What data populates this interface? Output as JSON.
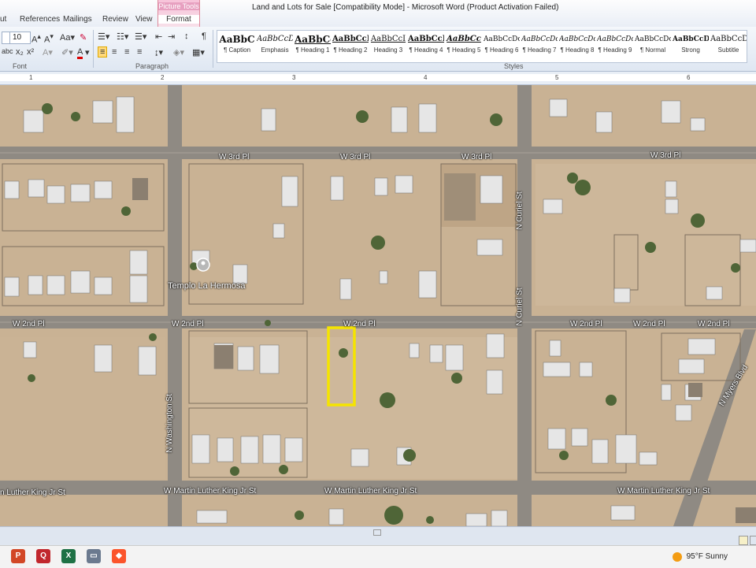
{
  "window": {
    "doc_title": "Land and Lots for Sale [Compatibility Mode]  -  Microsoft Word (Product Activation Failed)"
  },
  "tabs": [
    "ut",
    "References",
    "Mailings",
    "Review",
    "View"
  ],
  "picture_tools": {
    "group": "Picture Tools",
    "tab": "Format"
  },
  "font": {
    "size": "10"
  },
  "groups": {
    "font": "Font",
    "paragraph": "Paragraph",
    "styles": "Styles"
  },
  "styles": [
    {
      "sample": "AaBbC",
      "name": "¶ Caption"
    },
    {
      "sample": "AaBbCcDc",
      "name": "Emphasis"
    },
    {
      "sample": "AaBbCc",
      "name": "¶ Heading 1"
    },
    {
      "sample": "AaBbCcI",
      "name": "¶ Heading 2"
    },
    {
      "sample": "AaBbCcI",
      "name": "Heading 3"
    },
    {
      "sample": "AaBbCcI",
      "name": "¶ Heading 4"
    },
    {
      "sample": "AaBbCc",
      "name": "¶ Heading 5"
    },
    {
      "sample": "AaBbCcDc",
      "name": "¶ Heading 6"
    },
    {
      "sample": "AaBbCcDc",
      "name": "¶ Heading 7"
    },
    {
      "sample": "AaBbCcDc",
      "name": "¶ Heading 8"
    },
    {
      "sample": "AaBbCcDc",
      "name": "¶ Heading 9"
    },
    {
      "sample": "AaBbCcDc",
      "name": "¶ Normal"
    },
    {
      "sample": "AaBbCcDd",
      "name": "Strong"
    },
    {
      "sample": "AaBbCcD",
      "name": "Subtitle"
    }
  ],
  "ruler_numbers": [
    "1",
    "2",
    "3",
    "4",
    "5",
    "6"
  ],
  "map": {
    "streets": {
      "w3rd": "W 3rd Pl",
      "w2nd": "W 2nd Pl",
      "mlk": "W Martin Luther King Jr St",
      "mlk_left": "n Luther King Jr St",
      "washington": "N Washington St",
      "curiel": "N Curiel St",
      "myers": "N Myers Blvd"
    },
    "poi": "Templo La Hermosa",
    "highlight_color": "#f5e400"
  },
  "taskbar": {
    "weather": "95°F  Sunny"
  }
}
